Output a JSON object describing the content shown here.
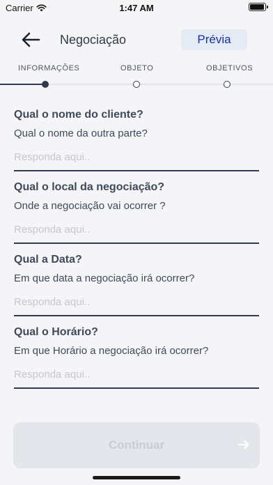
{
  "status_bar": {
    "carrier": "Carrier",
    "time": "1:47 AM"
  },
  "header": {
    "title": "Negociação",
    "preview_label": "Prévia"
  },
  "stepper": {
    "steps": [
      {
        "label": "INFORMAÇÕES",
        "active": true
      },
      {
        "label": "OBJETO",
        "active": false
      },
      {
        "label": "OBJETIVOS",
        "active": false
      }
    ]
  },
  "questions": [
    {
      "title": "Qual o nome do cliente?",
      "subtitle": "Qual o nome da outra parte?",
      "placeholder": "Responda aqui..",
      "value": ""
    },
    {
      "title": "Qual o local da negociação?",
      "subtitle": "Onde a negociação vai ocorrer ?",
      "placeholder": "Responda aqui..",
      "value": ""
    },
    {
      "title": "Qual a Data?",
      "subtitle": "Em que data a negociação irá ocorrer?",
      "placeholder": "Responda aqui..",
      "value": ""
    },
    {
      "title": "Qual o Horário?",
      "subtitle": "Em que Horário a negociação irá ocorrer?",
      "placeholder": "Responda aqui..",
      "value": ""
    }
  ],
  "footer": {
    "continue_label": "Continuar"
  },
  "colors": {
    "primary": "#2f3b4c",
    "accent": "#1a2fa3",
    "preview_bg": "#e4ebf5",
    "disabled_bg": "#e3e6ea"
  },
  "icons": {
    "back": "arrow-left-icon",
    "continue": "arrow-right-icon",
    "wifi": "wifi-icon",
    "battery": "battery-icon"
  }
}
